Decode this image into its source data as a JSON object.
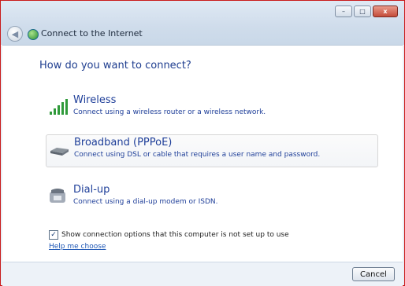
{
  "window": {
    "title": "Connect to the Internet",
    "caption_buttons": {
      "minimize": "–",
      "maximize": "□",
      "close": "x"
    }
  },
  "main": {
    "heading": "How do you want to connect?",
    "options": [
      {
        "title": "Wireless",
        "description": "Connect using a wireless router or a wireless network.",
        "icon": "signal-bars-icon"
      },
      {
        "title": "Broadband (PPPoE)",
        "description": "Connect using DSL or cable that requires a user name and password.",
        "icon": "modem-icon",
        "selected": true
      },
      {
        "title": "Dial-up",
        "description": "Connect using a dial-up modem or ISDN.",
        "icon": "phone-icon"
      }
    ],
    "show_options_label": "Show connection options that this computer is not set up to use",
    "show_options_checked": true,
    "help_link": "Help me choose"
  },
  "footer": {
    "cancel_label": "Cancel"
  }
}
